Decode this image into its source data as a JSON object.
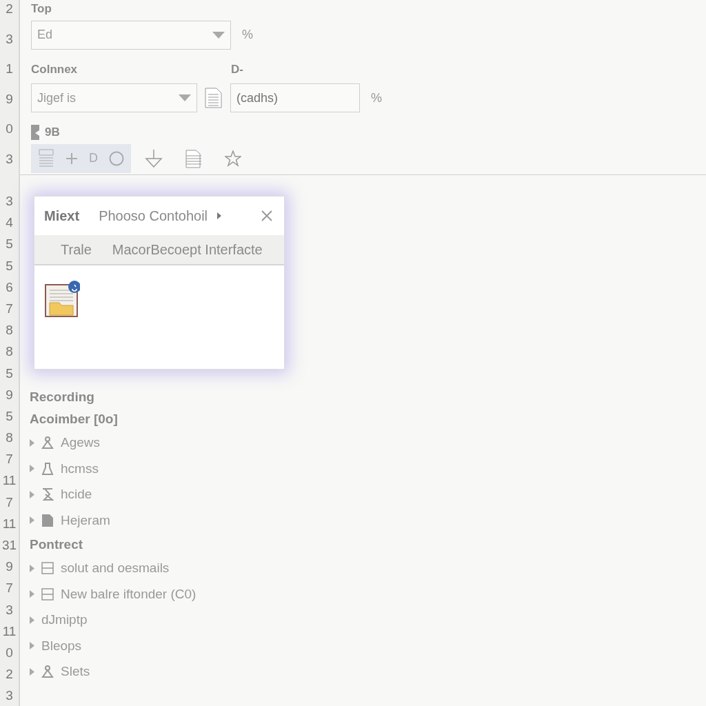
{
  "gutter": {
    "top_numbers": [
      "2",
      "3",
      "1",
      "9",
      "0",
      "3"
    ],
    "bottom_numbers": [
      "3",
      "4",
      "5",
      "5",
      "6",
      "7",
      "8",
      "8",
      "5",
      "9",
      "5",
      "8",
      "7",
      "11",
      "7",
      "11",
      "31",
      "9",
      "7",
      "3",
      "11",
      "0",
      "2",
      "3"
    ]
  },
  "form": {
    "top_label": "Top",
    "top_select": {
      "value": "Ed"
    },
    "top_unit": "%",
    "combo_label": "Colnnex",
    "combo_select": {
      "value": "Jigef is"
    },
    "d_label": "D-",
    "d_field": {
      "placeholder": "(cadhs)"
    },
    "d_unit": "%",
    "size_label": "9B",
    "toolbar": [
      {
        "kind": "list",
        "selected": true
      },
      {
        "kind": "plus",
        "selected": true
      },
      {
        "kind": "letter",
        "text": "D",
        "selected": true
      },
      {
        "kind": "circle",
        "selected": true
      },
      {
        "kind": "down",
        "selected": false
      },
      {
        "kind": "doc",
        "selected": false
      },
      {
        "kind": "star",
        "selected": false
      }
    ]
  },
  "dialog": {
    "tabs": [
      {
        "label": "Miext",
        "selected": true
      },
      {
        "label": "Phooso Contohoil",
        "selected": false
      }
    ],
    "subtabs": [
      {
        "label": "Trale"
      },
      {
        "label": "MacorBecoept Interfacte"
      }
    ]
  },
  "tree": [
    {
      "kind": "heading",
      "label": "Recording"
    },
    {
      "kind": "heading",
      "label": "Acoimber [0o]"
    },
    {
      "kind": "person",
      "label": "Agews",
      "expanded": false
    },
    {
      "kind": "flask",
      "label": "hcmss",
      "expanded": false
    },
    {
      "kind": "hourglass",
      "label": "hcide",
      "expanded": false
    },
    {
      "kind": "file",
      "label": "Hejeram",
      "expanded": false
    },
    {
      "kind": "heading",
      "label": "Pontrect"
    },
    {
      "kind": "panel",
      "label": "solut and oesmails",
      "expanded": false
    },
    {
      "kind": "panel",
      "label": "New balre iftonder (C0)",
      "expanded": false
    },
    {
      "kind": "plain",
      "label": "dJmiptp",
      "expanded": false
    },
    {
      "kind": "plain",
      "label": "Bleops",
      "expanded": false
    },
    {
      "kind": "person",
      "label": "Slets",
      "expanded": false
    }
  ]
}
